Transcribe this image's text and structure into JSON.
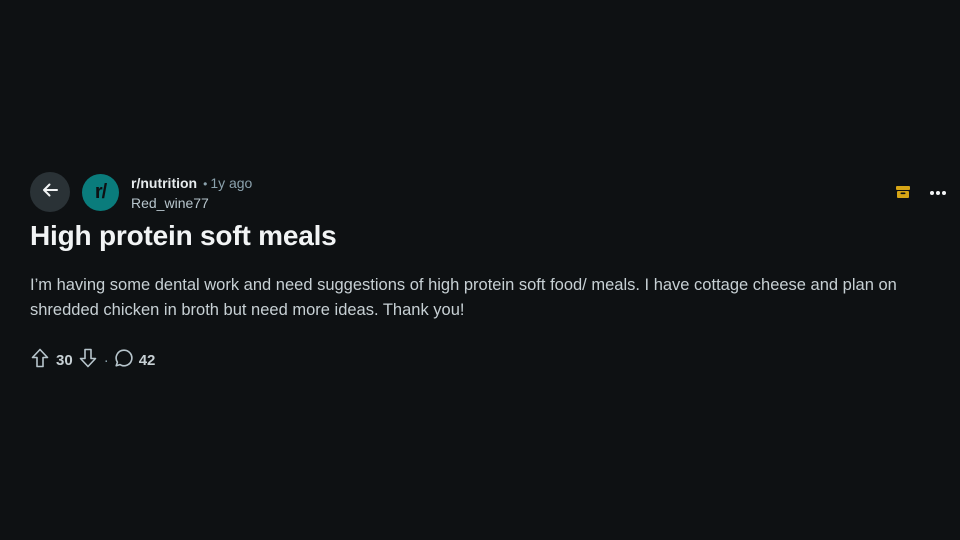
{
  "post": {
    "subreddit": "r/nutrition",
    "subreddit_avatar_text": "r/",
    "time_ago": "1y ago",
    "separator": "•",
    "author": "Red_wine77",
    "title": "High protein soft meals",
    "body": "I’m having some dental work and need suggestions of high protein soft food/ meals. I have cottage cheese and plan on shredded chicken in broth but need more ideas. Thank you!",
    "score": "30",
    "footer_separator": "·",
    "comment_count": "42"
  },
  "icons": {
    "back": "arrow-left-icon",
    "archive": "archive-icon",
    "more": "more-horizontal-icon",
    "upvote": "arrow-up-outline-icon",
    "downvote": "arrow-down-outline-icon",
    "comment": "speech-bubble-icon"
  },
  "colors": {
    "background": "#0e1113",
    "avatar": "#0a7c7c",
    "archive": "#d6a516",
    "back_button": "#2a3236"
  }
}
